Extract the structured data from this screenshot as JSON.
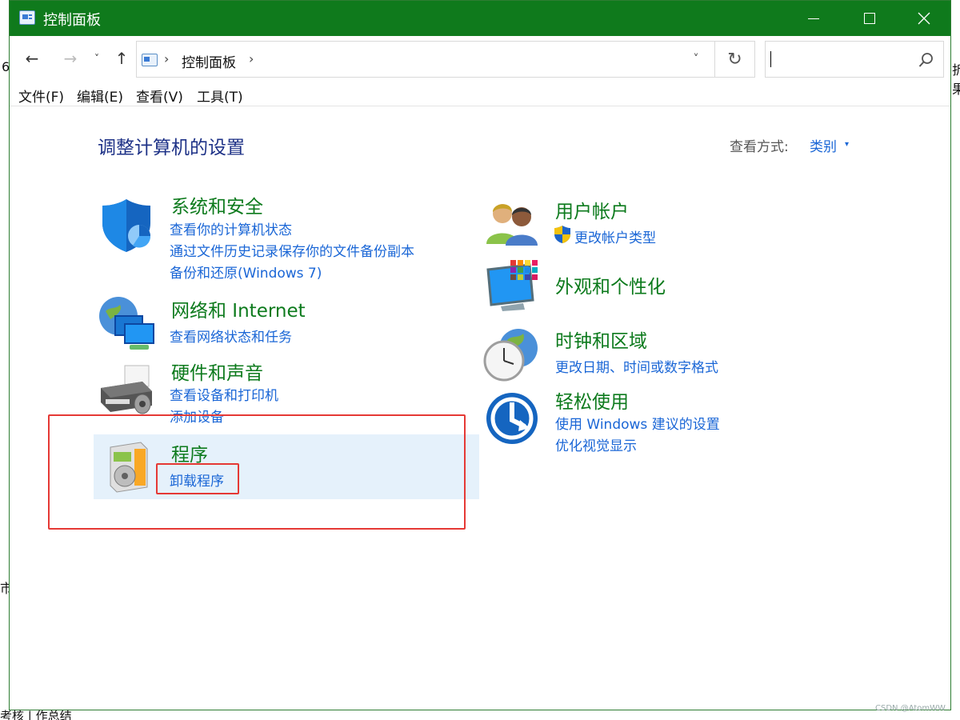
{
  "window": {
    "title": "控制面板",
    "controls": {
      "minimize": "—",
      "maximize": "☐",
      "close": "✕"
    }
  },
  "navbar": {
    "back_icon": "←",
    "forward_icon": "→",
    "recent_icon": "˅",
    "up_icon": "↑",
    "address": {
      "separator": "›",
      "text": "控制面板",
      "trailing_separator": "›"
    },
    "address_dropdown_icon": "˅",
    "refresh_icon": "↻",
    "search": {
      "value": "",
      "placeholder": ""
    }
  },
  "menubar": {
    "items": [
      "文件(F)",
      "编辑(E)",
      "查看(V)",
      "工具(T)"
    ]
  },
  "content": {
    "page_title": "调整计算机的设置",
    "view_by_label": "查看方式:",
    "view_by_value": "类别",
    "view_by_caret": "▾",
    "categories": [
      {
        "title": "系统和安全",
        "icon": "security-shield-icon",
        "links": [
          "查看你的计算机状态",
          "通过文件历史记录保存你的文件备份副本",
          "备份和还原(Windows 7)"
        ]
      },
      {
        "title": "网络和 Internet",
        "icon": "network-globe-icon",
        "links": [
          "查看网络状态和任务"
        ]
      },
      {
        "title": "硬件和声音",
        "icon": "printer-icon",
        "links": [
          "查看设备和打印机",
          "添加设备"
        ]
      },
      {
        "title": "程序",
        "icon": "programs-disc-icon",
        "links": [
          "卸载程序"
        ]
      },
      {
        "title": "用户帐户",
        "icon": "users-icon",
        "links": [
          "更改帐户类型"
        ]
      },
      {
        "title": "外观和个性化",
        "icon": "monitor-palette-icon",
        "links": []
      },
      {
        "title": "时钟和区域",
        "icon": "clock-globe-icon",
        "links": [
          "更改日期、时间或数字格式"
        ]
      },
      {
        "title": "轻松使用",
        "icon": "ease-of-access-icon",
        "links": [
          "使用 Windows 建议的设置",
          "优化视觉显示"
        ]
      }
    ]
  },
  "desktop": {
    "left_edge_chars": [
      "6",
      "市"
    ],
    "right_edge_chars": [
      "折",
      "果"
    ],
    "taskbar_text": "考核 | 作总结",
    "watermark": "CSDN @AtomWW"
  },
  "colors": {
    "titlebar": "#0f7a1c",
    "category_title": "#0c7a1c",
    "link": "#1a66d6",
    "page_title": "#1e3287",
    "highlight": "#e5f1fb",
    "annotation_red": "#e53935"
  }
}
